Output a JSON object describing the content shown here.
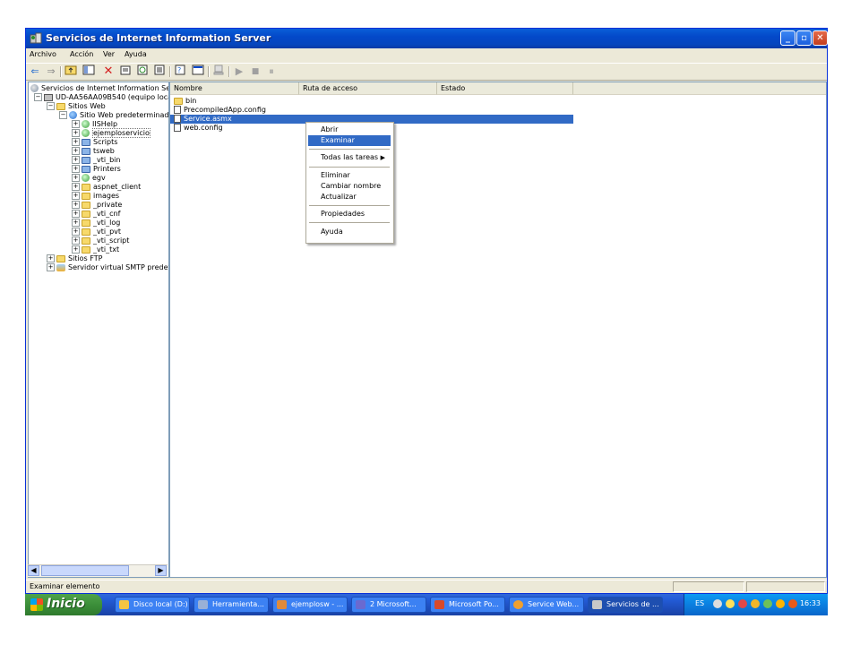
{
  "window": {
    "title": "Servicios de Internet Information Server"
  },
  "menu": [
    "Archivo",
    "Acción",
    "Ver",
    "Ayuda"
  ],
  "tree": {
    "root": "Servicios de Internet Information Se",
    "computer": "UD-AA56AA09B540 (equipo loca",
    "websites": "Sitios Web",
    "default_site": "Sitio Web predeterminad",
    "children": [
      "IISHelp",
      "ejemploservicio",
      "Scripts",
      "tsweb",
      "_vti_bin",
      "Printers",
      "egv",
      "aspnet_client",
      "images",
      "_private",
      "_vti_cnf",
      "_vti_log",
      "_vti_pvt",
      "_vti_script",
      "_vti_txt"
    ],
    "ftp": "Sitios FTP",
    "smtp": "Servidor virtual SMTP predet"
  },
  "list": {
    "columns": [
      "Nombre",
      "Ruta de acceso",
      "Estado"
    ],
    "rows": [
      {
        "name": "bin",
        "icon": "folder-icon"
      },
      {
        "name": "PrecompiledApp.config",
        "icon": "file-icon"
      },
      {
        "name": "Service.asmx",
        "icon": "file-icon",
        "selected": true
      },
      {
        "name": "web.config",
        "icon": "file-icon"
      }
    ]
  },
  "context_menu": {
    "items": [
      "Abrir",
      "Examinar",
      "Todas las tareas",
      "Eliminar",
      "Cambiar nombre",
      "Actualizar",
      "Propiedades",
      "Ayuda"
    ],
    "highlighted": "Examinar",
    "submenu_arrow": "▶"
  },
  "status": "Examinar elemento",
  "taskbar": {
    "start": "Inicio",
    "tasks": [
      "Disco local (D:)",
      "Herramienta...",
      "ejemplosw - ...",
      "2 Microsoft...",
      "Microsoft Po...",
      "Service Web...",
      "Servicios de ..."
    ],
    "active_task": "Servicios de ...",
    "lang": "ES",
    "clock": "16:33"
  },
  "colors": {
    "title_blue": "#0348c9",
    "selection": "#316ac5",
    "start_green": "#3c8f3a"
  }
}
